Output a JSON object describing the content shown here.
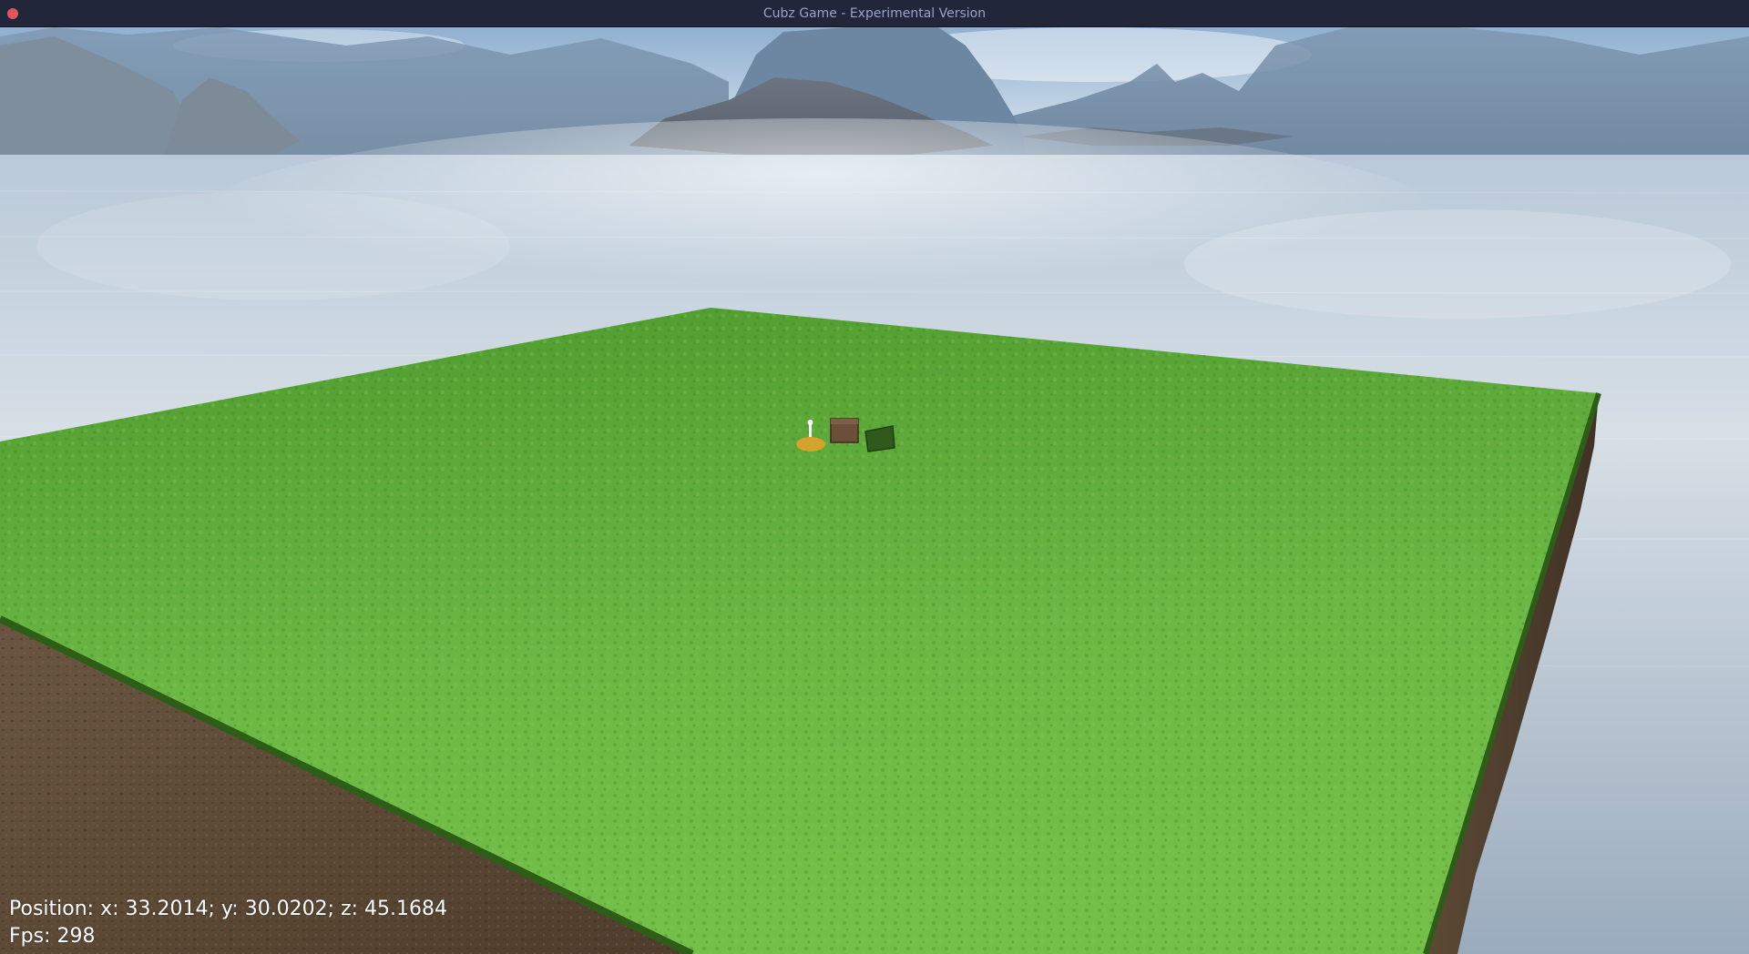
{
  "window": {
    "title": "Cubz Game - Experimental Version"
  },
  "hud": {
    "position_text": "Position: x: 33.2014; y: 30.0202; z: 45.1684",
    "fps_text": "Fps: 298"
  },
  "colors": {
    "titlebar": "#22263a",
    "title_text": "#9aa3c7",
    "close_button": "#e0555f",
    "sky_top": "#8fb0d0",
    "sky_horizon": "#e9eef3",
    "mountain": "#6e8aa6",
    "water": "#9fb1c6",
    "grass": "#5fae3a",
    "dirt": "#5d4a36"
  },
  "icons": {
    "close": "close-dot-icon"
  }
}
